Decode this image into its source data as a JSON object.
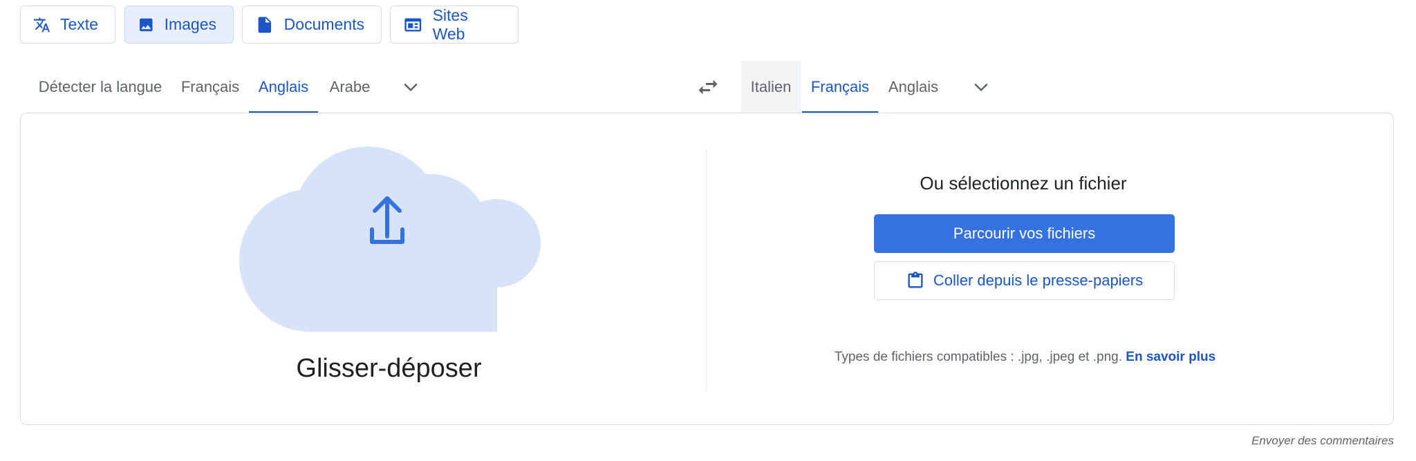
{
  "mode_tabs": [
    {
      "label": "Texte",
      "icon": "translate-icon",
      "active": false
    },
    {
      "label": "Images",
      "icon": "image-icon",
      "active": true
    },
    {
      "label": "Documents",
      "icon": "document-icon",
      "active": false
    },
    {
      "label": "Sites Web",
      "icon": "website-icon",
      "active": false
    }
  ],
  "source_languages": [
    "Détecter la langue",
    "Français",
    "Anglais",
    "Arabe"
  ],
  "source_selected": "Anglais",
  "target_languages": [
    "Italien",
    "Français",
    "Anglais"
  ],
  "target_selected": "Français",
  "icons": {
    "swap": "swap-languages-icon",
    "more_source": "chevron-down-icon",
    "more_target": "chevron-down-icon",
    "upload": "cloud-upload-icon",
    "clipboard": "clipboard-icon"
  },
  "upload": {
    "drop_label": "Glisser-déposer",
    "or_select": "Ou sélectionnez un fichier",
    "browse_button": "Parcourir vos fichiers",
    "paste_button": "Coller depuis le presse-papiers",
    "file_types_text": "Types de fichiers compatibles : .jpg, .jpeg et .png.",
    "learn_more": "En savoir plus"
  },
  "feedback": "Envoyer des commentaires",
  "colors": {
    "accent": "#1a56c6",
    "button_primary": "#3572e0",
    "cloud_fill": "#d6e3f8",
    "active_tab_bg": "#e8eefb"
  }
}
